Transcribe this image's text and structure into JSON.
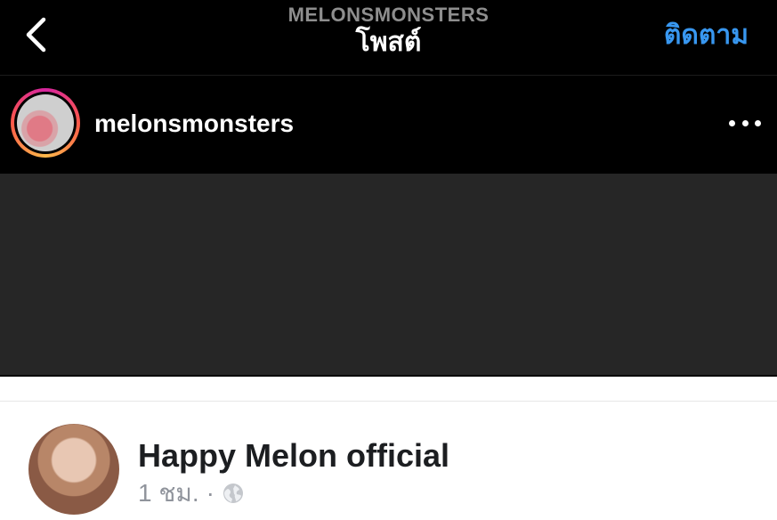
{
  "instagram": {
    "header": {
      "subtitle": "MELONSMONSTERS",
      "title": "โพสต์",
      "follow_label": "ติดตาม"
    },
    "post": {
      "username": "melonsmonsters"
    }
  },
  "facebook": {
    "page_name": "Happy Melon official",
    "time": "1 ชม.",
    "separator": "·"
  },
  "colors": {
    "accent_blue": "#3897f0",
    "ig_background": "#000000",
    "media_placeholder": "#262626"
  },
  "icons": [
    "back-chevron-icon",
    "more-dots-icon",
    "globe-icon"
  ]
}
